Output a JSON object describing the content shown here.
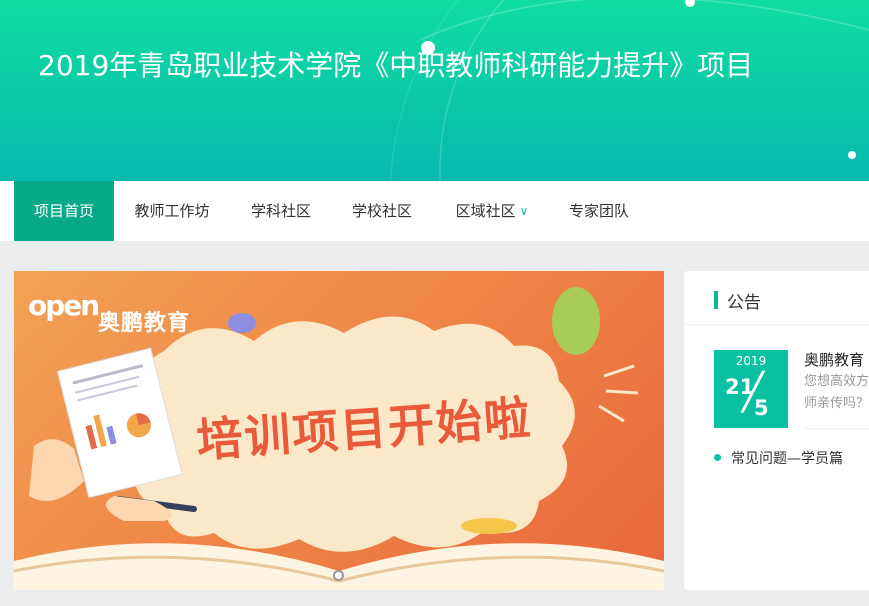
{
  "header": {
    "title": "2019年青岛职业技术学院《中职教师科研能力提升》项目"
  },
  "nav": {
    "items": [
      {
        "label": "项目首页",
        "active": true
      },
      {
        "label": "教师工作坊"
      },
      {
        "label": "学科社区"
      },
      {
        "label": "学校社区"
      },
      {
        "label": "区域社区",
        "has_dropdown": true,
        "icon": "chevron-down-icon"
      },
      {
        "label": "专家团队"
      }
    ]
  },
  "carousel": {
    "logo_text": "奥鹏教育",
    "logo_mark": "open",
    "headline": "培训项目开始啦",
    "colors": {
      "accent": "#e85a39",
      "background": "#ef8447"
    }
  },
  "announcement": {
    "title": "公告",
    "news": {
      "year": "2019",
      "day": "21",
      "month": "5",
      "title": "奥鹏教育",
      "desc": "您想高效方 师亲传吗？"
    },
    "items": [
      {
        "label": "常见问题—学员篇"
      }
    ]
  },
  "colors": {
    "brand": "#07a988",
    "header_gradient_top": "#10dca0",
    "header_gradient_bottom": "#06b9b0"
  }
}
